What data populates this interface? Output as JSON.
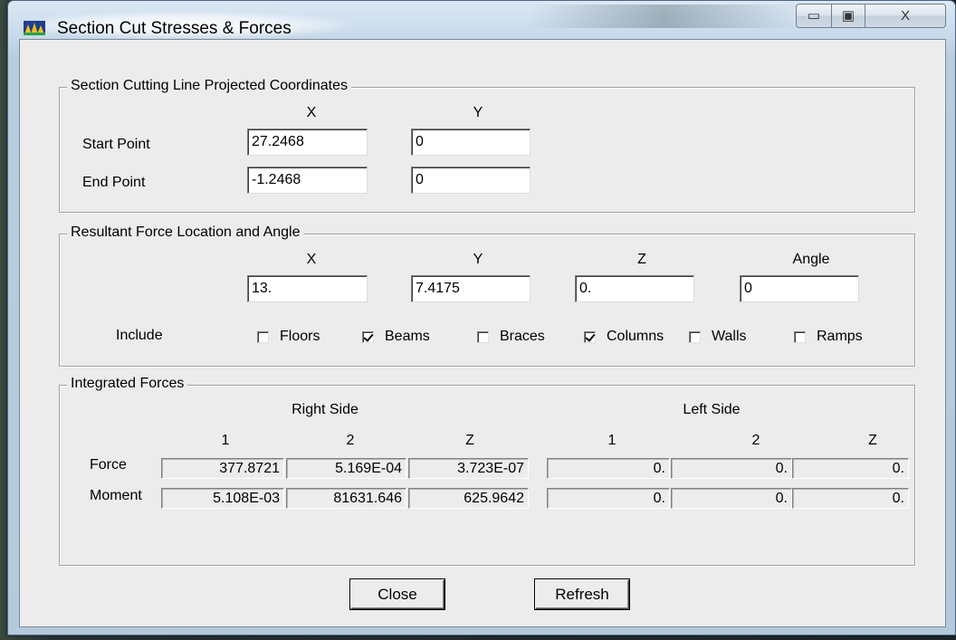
{
  "window": {
    "title": "Section Cut Stresses & Forces",
    "icon": "etabs-app-icon",
    "controls": {
      "minimize": "▭",
      "maximize": "▣",
      "close": "X"
    }
  },
  "cutting_line": {
    "legend": "Section Cutting Line Projected Coordinates",
    "col_x": "X",
    "col_y": "Y",
    "start_label": "Start Point",
    "end_label": "End Point",
    "start_x": "27.2468",
    "start_y": "0",
    "end_x": "-1.2468",
    "end_y": "0"
  },
  "resultant": {
    "legend": "Resultant Force Location and Angle",
    "col_x": "X",
    "col_y": "Y",
    "col_z": "Z",
    "col_angle": "Angle",
    "x": "13.",
    "y": "7.4175",
    "z": "0.",
    "angle": "0",
    "include_label": "Include",
    "include": [
      {
        "label": "Floors",
        "checked": false
      },
      {
        "label": "Beams",
        "checked": true
      },
      {
        "label": "Braces",
        "checked": false
      },
      {
        "label": "Columns",
        "checked": true
      },
      {
        "label": "Walls",
        "checked": false
      },
      {
        "label": "Ramps",
        "checked": false
      }
    ]
  },
  "integrated": {
    "legend": "Integrated Forces",
    "right_side": "Right Side",
    "left_side": "Left Side",
    "cols": [
      "1",
      "2",
      "Z"
    ],
    "force_label": "Force",
    "moment_label": "Moment",
    "right_force": [
      "377.8721",
      "5.169E-04",
      "3.723E-07"
    ],
    "right_moment": [
      "5.108E-03",
      "81631.646",
      "625.9642"
    ],
    "left_force": [
      "0.",
      "0.",
      "0."
    ],
    "left_moment": [
      "0.",
      "0.",
      "0."
    ]
  },
  "buttons": {
    "close": "Close",
    "refresh": "Refresh"
  }
}
